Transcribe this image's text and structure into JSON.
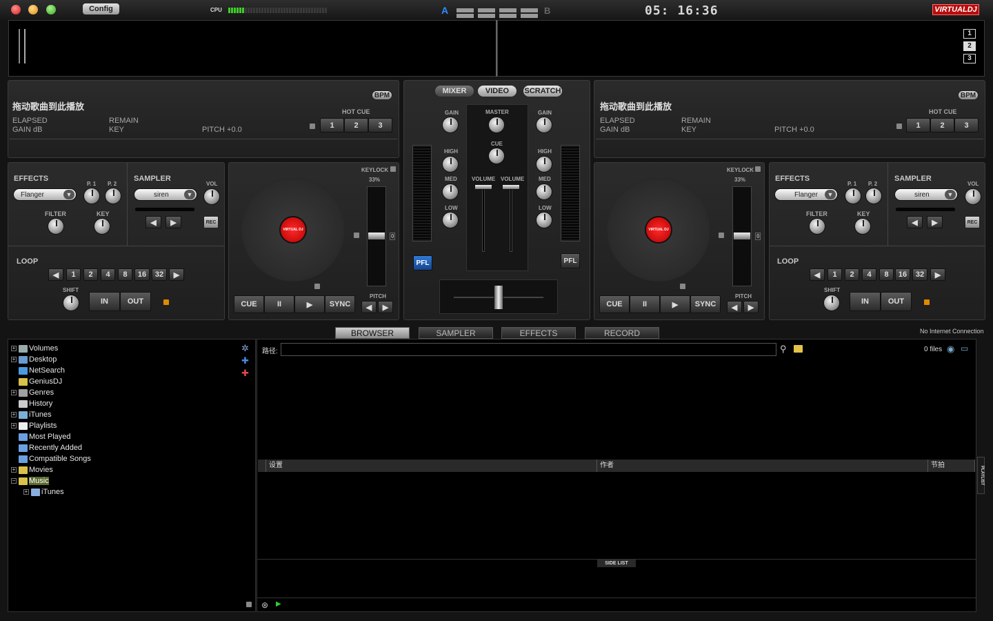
{
  "topbar": {
    "config_label": "Config",
    "cpu_label": "CPU",
    "crossfader_a": "A",
    "crossfader_b": "B",
    "clock": "05: 16:36",
    "logo": "VIRTUALDJ"
  },
  "screens": [
    "1",
    "2",
    "3"
  ],
  "deck_left": {
    "drop_text": "拖动歌曲到此播放",
    "bpm_label": "BPM",
    "elapsed": "ELAPSED",
    "gain_db": "GAIN dB",
    "remain": "REMAIN",
    "key": "KEY",
    "pitch": "PITCH +0.0",
    "hot_cue_label": "HOT CUE",
    "hot_cues": [
      "1",
      "2",
      "3"
    ],
    "effects_label": "EFFECTS",
    "effect_selected": "Flanger",
    "p1": "P. 1",
    "p2": "P. 2",
    "filter": "FILTER",
    "key_knob": "KEY",
    "sampler_label": "SAMPLER",
    "sampler_selected": "siren",
    "vol": "VOL",
    "rec": "REC",
    "loop_label": "LOOP",
    "loop_values": [
      "1",
      "2",
      "4",
      "8",
      "16",
      "32"
    ],
    "shift": "SHIFT",
    "in": "IN",
    "out": "OUT",
    "keylock": "KEYLOCK",
    "keylock_pct": "33%",
    "pitch_zero": "0",
    "pitch_label": "PITCH",
    "cue": "CUE",
    "pause": "II",
    "sync": "SYNC",
    "platter_label": "VIRTUAL DJ"
  },
  "deck_right": {
    "drop_text": "拖动歌曲到此播放",
    "bpm_label": "BPM",
    "elapsed": "ELAPSED",
    "gain_db": "GAIN dB",
    "remain": "REMAIN",
    "key": "KEY",
    "pitch": "PITCH +0.0",
    "hot_cue_label": "HOT CUE",
    "hot_cues": [
      "1",
      "2",
      "3"
    ],
    "effects_label": "EFFECTS",
    "effect_selected": "Flanger",
    "p1": "P. 1",
    "p2": "P. 2",
    "filter": "FILTER",
    "key_knob": "KEY",
    "sampler_label": "SAMPLER",
    "sampler_selected": "siren",
    "vol": "VOL",
    "rec": "REC",
    "loop_label": "LOOP",
    "loop_values": [
      "1",
      "2",
      "4",
      "8",
      "16",
      "32"
    ],
    "shift": "SHIFT",
    "in": "IN",
    "out": "OUT",
    "keylock": "KEYLOCK",
    "keylock_pct": "33%",
    "pitch_zero": "0",
    "pitch_label": "PITCH",
    "cue": "CUE",
    "pause": "II",
    "sync": "SYNC",
    "platter_label": "VIRTUAL DJ"
  },
  "mixer": {
    "tabs": [
      "MIXER",
      "VIDEO",
      "SCRATCH"
    ],
    "gain": "GAIN",
    "master": "MASTER",
    "cue": "CUE",
    "high": "HIGH",
    "med": "MED",
    "low": "LOW",
    "volume": "VOLUME",
    "pfl": "PFL"
  },
  "browser": {
    "tabs": [
      "BROWSER",
      "SAMPLER",
      "EFFECTS",
      "RECORD"
    ],
    "connection_status": "No Internet Connection",
    "path_label": "路径:",
    "path_value": "",
    "file_count": "0 files",
    "columns": [
      "设置",
      "作者",
      "节拍"
    ],
    "side_list": "SIDE LIST",
    "playlist_tab": "PLAYLIST",
    "tree": [
      {
        "label": "Volumes",
        "expander": "+"
      },
      {
        "label": "Desktop",
        "expander": "+"
      },
      {
        "label": "NetSearch",
        "expander": ""
      },
      {
        "label": "GeniusDJ",
        "expander": ""
      },
      {
        "label": "Genres",
        "expander": "+"
      },
      {
        "label": "History",
        "expander": ""
      },
      {
        "label": "iTunes",
        "expander": "+"
      },
      {
        "label": "Playlists",
        "expander": "+"
      },
      {
        "label": "Most Played",
        "expander": ""
      },
      {
        "label": "Recently Added",
        "expander": ""
      },
      {
        "label": "Compatible Songs",
        "expander": ""
      },
      {
        "label": "Movies",
        "expander": "+"
      },
      {
        "label": "Music",
        "expander": "−"
      },
      {
        "label": "iTunes",
        "expander": "+"
      }
    ]
  },
  "colors": {
    "accent_red": "#c40c0c",
    "pfl_blue": "#1a5fb4",
    "crossfader_blue": "#2f8cff",
    "lock_orange": "#e08a00"
  }
}
